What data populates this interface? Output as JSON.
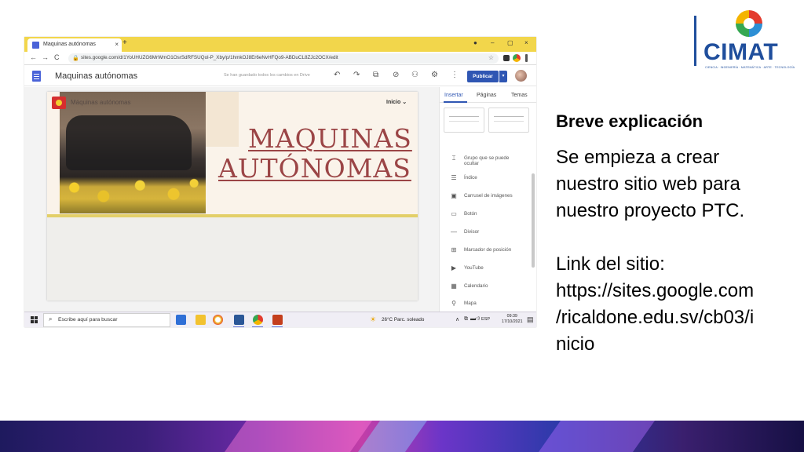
{
  "slide": {
    "logo": {
      "word": "CIMAT",
      "tagline": "CIENCIA · INGENIERÍA · MATEMÁTICA · ARTE · TECNOLOGÍA"
    },
    "heading": "Breve explicación",
    "body_lines": [
      "Se empieza a crear",
      "nuestro sitio web para",
      "nuestro proyecto PTC."
    ],
    "link_lines": [
      "Link del sitio:",
      "https://sites.google.com",
      "/ricaldone.edu.sv/cb03/i",
      "nicio"
    ]
  },
  "browser": {
    "tab_title": "Maquinas autónomas",
    "tab_close": "×",
    "new_tab": "+",
    "window_controls": [
      "●",
      "–",
      "▢",
      "×"
    ],
    "url": "sites.google.com/d/1YoUHUZG6MrWmO1OsrSdRFSUQol-P_Xby/p/1hmkOJ8Er6eNvHFQo9-ABDuCL8ZJc2OCX/edit",
    "nav": {
      "back": "←",
      "forward": "→",
      "reload": "C",
      "lock": "🔒",
      "star": "☆"
    }
  },
  "sites_toolbar": {
    "site_name": "Maquinas autónomas",
    "saved_status": "Se han guardado todos los cambios en Drive",
    "tools": [
      "↶",
      "↷",
      "⧉",
      "⊘",
      "⚇",
      "⚙",
      "⋮"
    ],
    "publish_label": "Publicar",
    "publish_arrow": "▾"
  },
  "page": {
    "ghost_text": "Máquinas autónomas",
    "nav_label": "Inicio ⌄",
    "title_line1": "MAQUINAS",
    "title_line2": "AUTÓNOMAS"
  },
  "panel": {
    "tabs": [
      "Insertar",
      "Páginas",
      "Temas"
    ],
    "items": [
      {
        "icon": "⌶",
        "label": "Grupo que se puede ocultar"
      },
      {
        "icon": "☰",
        "label": "Índice"
      },
      {
        "icon": "▣",
        "label": "Carrusel de imágenes"
      },
      {
        "icon": "▭",
        "label": "Botón"
      },
      {
        "icon": "—",
        "label": "Divisor"
      },
      {
        "icon": "⊞",
        "label": "Marcador de posición"
      },
      {
        "icon": "▶",
        "label": "YouTube"
      },
      {
        "icon": "▦",
        "label": "Calendario"
      },
      {
        "icon": "⚲",
        "label": "Mapa"
      }
    ]
  },
  "taskbar": {
    "search_placeholder": "Escribe aquí para buscar",
    "weather": "26°C  Parc. soleado",
    "tray_symbols": [
      "∧",
      "⧉",
      "▬",
      "◁)"
    ],
    "language": "ESP",
    "time": "09:39",
    "date": "17/10/2021"
  },
  "colors": {
    "tabstrip": "#f2d64b",
    "publish": "#2f56b3",
    "title": "#9b4546",
    "logo_blue": "#1f4e9c"
  }
}
